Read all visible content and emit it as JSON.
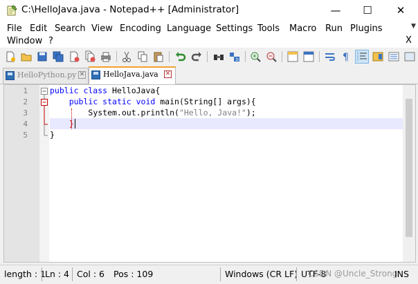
{
  "window": {
    "title": "C:\\HelloJava.java - Notepad++ [Administrator]",
    "minimize_glyph": "—",
    "maximize_glyph": "☐",
    "close_glyph": "✕"
  },
  "menu": {
    "row1": [
      "File",
      "Edit",
      "Search",
      "View",
      "Encoding",
      "Language",
      "Settings",
      "Tools",
      "Macro",
      "Run",
      "Plugins"
    ],
    "row2": [
      "Window",
      "?"
    ],
    "close_doc": "X",
    "overflow": "▼"
  },
  "toolbar": {
    "icons": [
      "new-file-icon",
      "open-file-icon",
      "save-icon",
      "save-all-icon",
      "close-icon",
      "close-all-icon",
      "print-icon",
      "cut-icon",
      "copy-icon",
      "paste-icon",
      "undo-icon",
      "redo-icon",
      "find-icon",
      "replace-icon",
      "zoom-in-icon",
      "zoom-out-icon",
      "sync-vertical-icon",
      "sync-horizontal-icon",
      "word-wrap-icon",
      "show-all-characters-icon",
      "indent-guide-icon",
      "document-map-icon",
      "function-list-icon"
    ]
  },
  "tabs": [
    {
      "label": "HelloPython.py",
      "active": false
    },
    {
      "label": "HelloJava.java",
      "active": true
    }
  ],
  "editor": {
    "line_numbers": [
      "1",
      "2",
      "3",
      "4",
      "5"
    ],
    "lines": [
      {
        "kw1": "public class",
        "rest": " HelloJava{"
      },
      {
        "indent": "    ",
        "kw1": "public static void",
        "rest": " main(String[] args){"
      },
      {
        "indent": "        ",
        "pre": "System.out.println(",
        "str": "\"Hello, Java!\"",
        "post": ");"
      },
      {
        "indent": "    ",
        "rest": "}"
      },
      {
        "rest": "}"
      }
    ],
    "colors": {
      "keyword": "#0000ff",
      "string": "#808080",
      "caret_line": "#e8e8ff",
      "fold_marker": "#c00000"
    }
  },
  "status": {
    "length": "length : 1",
    "ln": "Ln : 4",
    "col": "Col : 6",
    "pos": "Pos : 109",
    "eol": "Windows (CR LF)",
    "encoding": "UTF-8",
    "watermark": "CSDN @Uncle_Strong",
    "ins": "INS"
  }
}
